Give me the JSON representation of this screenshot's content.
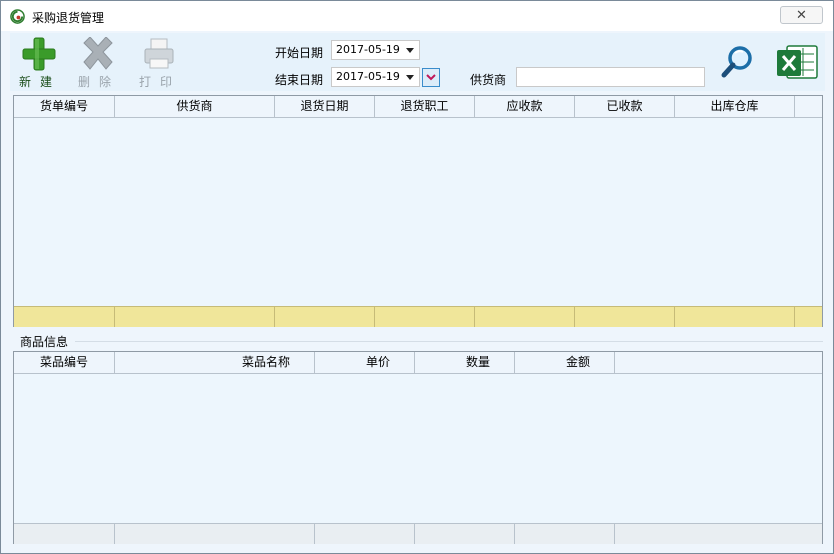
{
  "window": {
    "title": "采购退货管理",
    "close_glyph": "✕"
  },
  "toolbar": {
    "new_label": "新建",
    "delete_label": "删除",
    "print_label": "打印"
  },
  "filters": {
    "start_label": "开始日期",
    "end_label": "结束日期",
    "start_date": "2017-05-19",
    "end_date": "2017-05-19",
    "supplier_label": "供货商",
    "supplier_value": ""
  },
  "colors": {
    "accent_green": "#3a9b2a",
    "delete_gray": "#9ea6ad",
    "totals_yellow": "#f0e69a",
    "excel_green": "#1e7a3a"
  },
  "icons": [
    "app-logo-icon",
    "plus-icon",
    "x-icon",
    "printer-icon",
    "magnifier-icon",
    "excel-icon"
  ],
  "returns_table": {
    "columns": [
      "货单编号",
      "供货商",
      "退货日期",
      "退货职工",
      "应收款",
      "已收款",
      "出库仓库"
    ]
  },
  "items_section": {
    "label": "商品信息",
    "columns": [
      "菜品编号",
      "菜品名称",
      "单价",
      "数量",
      "金额"
    ]
  }
}
